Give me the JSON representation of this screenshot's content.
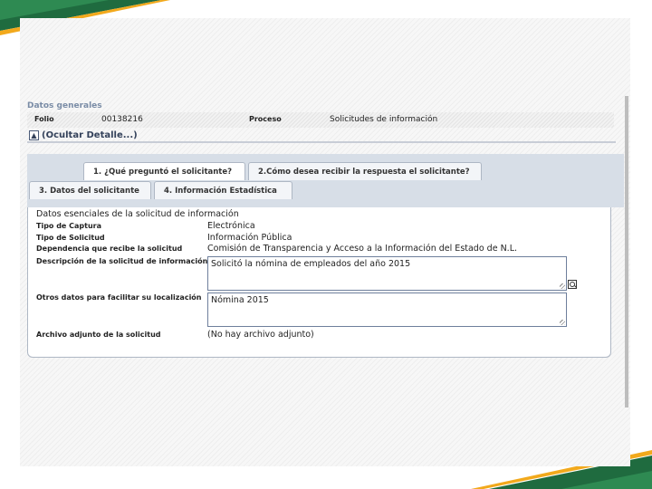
{
  "general": {
    "section_title": "Datos generales",
    "folio_label": "Folio",
    "folio_value": "00138216",
    "process_label": "Proceso",
    "process_value": "Solicitudes de información",
    "hide_details": "(Ocultar Detalle...)"
  },
  "tabs": [
    {
      "label": "1. ¿Qué preguntó el solicitante?",
      "active": true
    },
    {
      "label": "2.Cómo desea recibir la respuesta el solicitante?",
      "active": false
    },
    {
      "label": "3. Datos del solicitante",
      "active": false
    },
    {
      "label": "4. Información Estadística",
      "active": false
    }
  ],
  "request": {
    "section_title": "Datos esenciales de la solicitud de información",
    "fields": [
      {
        "label": "Tipo de Captura",
        "value": "Electrónica"
      },
      {
        "label": "Tipo de Solicitud",
        "value": "Información Pública"
      },
      {
        "label": "Dependencia que recibe la solicitud",
        "value": "Comisión de Transparencia y Acceso a la Información del Estado de N.L."
      },
      {
        "label": "Descripción de la solicitud de información",
        "value": "Solicitó la nómina de empleados del año 2015"
      },
      {
        "label": "Otros datos para facilitar su localización",
        "value": "Nómina 2015"
      },
      {
        "label": "Archivo adjunto de la solicitud",
        "value": "(No hay archivo adjunto)"
      }
    ]
  },
  "colors": {
    "brand_green": "#1f6b3f",
    "brand_gold": "#f2a91c",
    "tab_strip": "#d7dee7"
  }
}
